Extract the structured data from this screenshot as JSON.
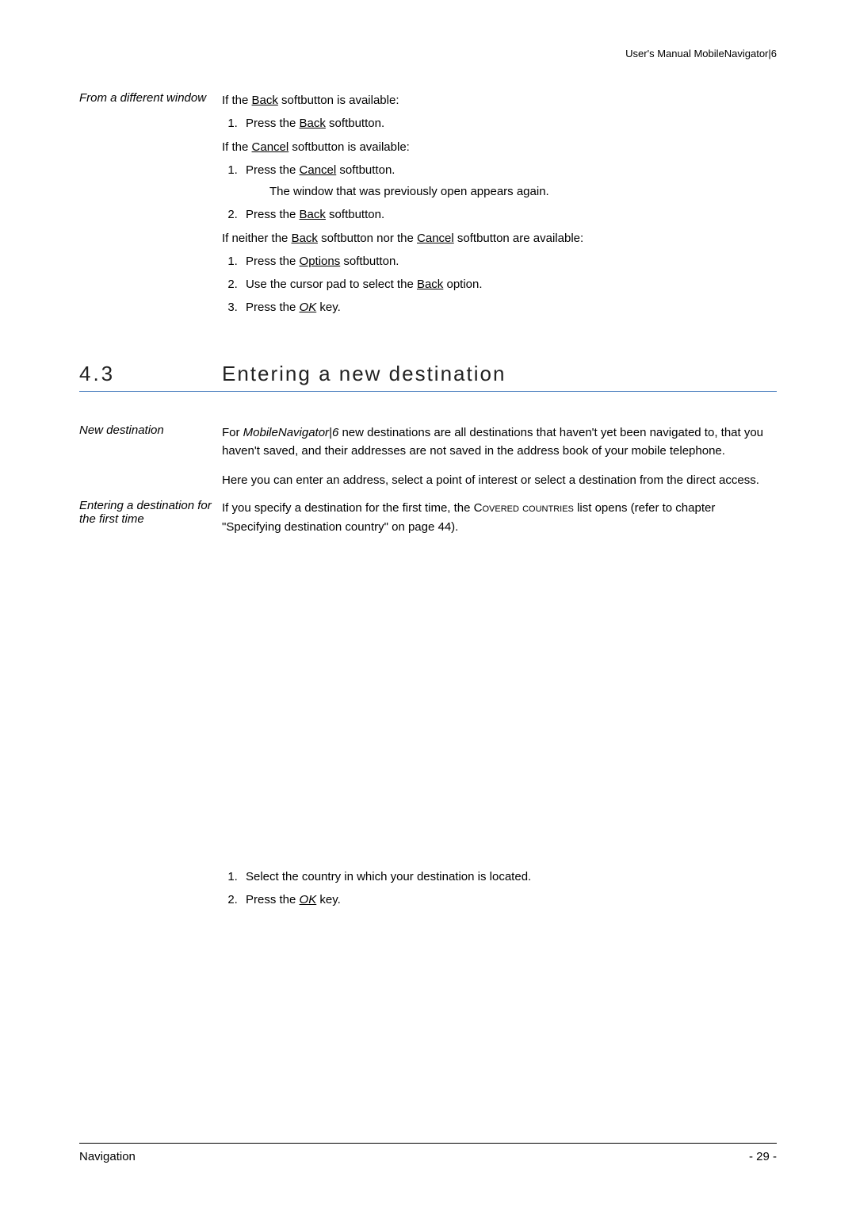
{
  "header": {
    "right": "User's Manual MobileNavigator|6"
  },
  "block1": {
    "margin": "From a different window",
    "p1_pre": "If the ",
    "back": "Back",
    "p1_post": " softbutton is available:",
    "l1_pre": "Press the ",
    "l1_post": " softbutton.",
    "p2_pre": "If the ",
    "cancel": "Cancel",
    "p2_post": " softbutton is available:",
    "l2a_pre": "Press the ",
    "l2a_post": " softbutton.",
    "l2a_sub": "The window that was previously open appears again.",
    "l2b_pre": "Press the ",
    "l2b_post": " softbutton.",
    "p3_pre": "If neither the ",
    "p3_mid": " softbutton nor the ",
    "p3_post": " softbutton are available:",
    "l3a_pre": "Press the ",
    "options": "Options",
    "l3a_post": " softbutton.",
    "l3b_pre": "Use the cursor pad to select the ",
    "l3b_post": " option.",
    "l3c_pre": "Press the ",
    "ok": "OK",
    "l3c_post": " key."
  },
  "section": {
    "num": "4.3",
    "title": "Entering a new destination"
  },
  "block2": {
    "margin": "New destination",
    "p1_pre": "For ",
    "product": "MobileNavigator|6",
    "p1_post": " new destinations are all destinations that haven't yet been navigated to, that you haven't saved, and their addresses are not saved in the address book of your mobile telephone.",
    "p2": "Here you can enter an address, select a point of interest or select a destination from the direct access."
  },
  "block3": {
    "margin": "Entering a destination for the first time",
    "p1_pre": "If you specify a destination for the first time, the ",
    "covered": "Covered countries",
    "p1_post": " list opens (refer to chapter \"Specifying destination country\" on page 44)."
  },
  "block4": {
    "l1": "Select the country in which your destination is located.",
    "l2_pre": "Press the ",
    "ok": "OK",
    "l2_post": " key."
  },
  "footer": {
    "left": "Navigation",
    "right": "- 29 -"
  }
}
